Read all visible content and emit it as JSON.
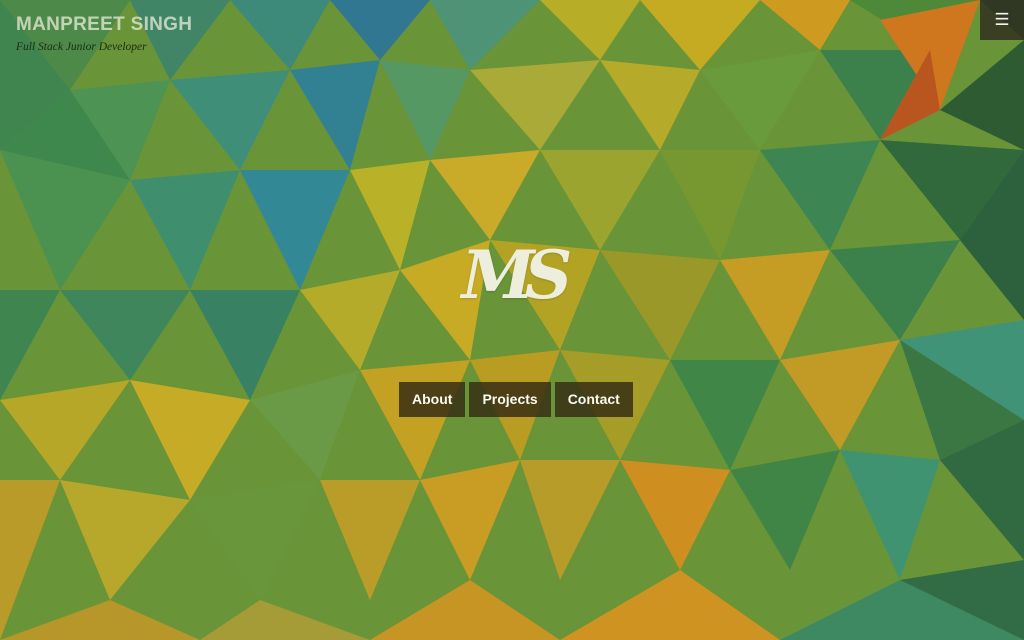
{
  "header": {
    "name": "MANPREET SINGH",
    "tagline": "Full Stack Junior Developer",
    "menu_icon": "hamburger-icon"
  },
  "hero": {
    "logo_text": "MS",
    "nav": [
      {
        "label": "About"
      },
      {
        "label": "Projects"
      },
      {
        "label": "Contact"
      }
    ]
  },
  "colors": {
    "nav_bg": "#342b14",
    "nav_text": "#fafaf2",
    "logo": "#eeeedc",
    "brand_name": "#f0f0e1",
    "tagline": "#1b2a12"
  }
}
